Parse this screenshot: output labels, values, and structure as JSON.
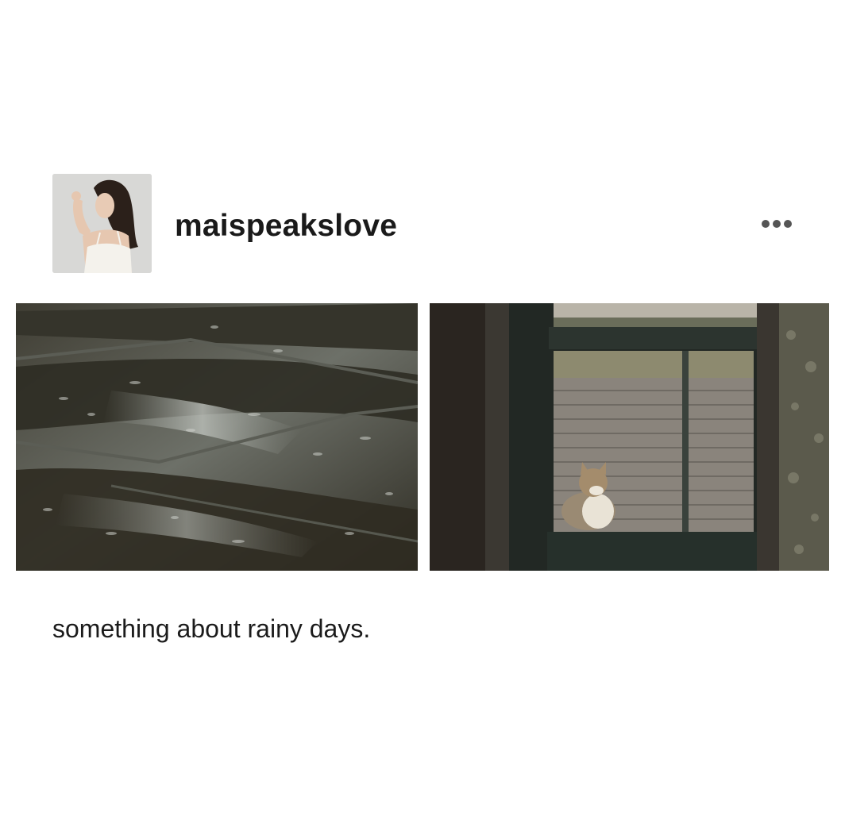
{
  "post": {
    "author": {
      "username": "maispeakslove",
      "avatar_icon": "profile-photo"
    },
    "menu_icon": "more-horizontal-icon",
    "photos": [
      {
        "name": "rain-puddle-photo"
      },
      {
        "name": "cat-window-photo"
      }
    ],
    "caption": "something about rainy days."
  },
  "colors": {
    "text": "#1b1b1b",
    "menu_dots": "#555555",
    "background": "#ffffff"
  }
}
